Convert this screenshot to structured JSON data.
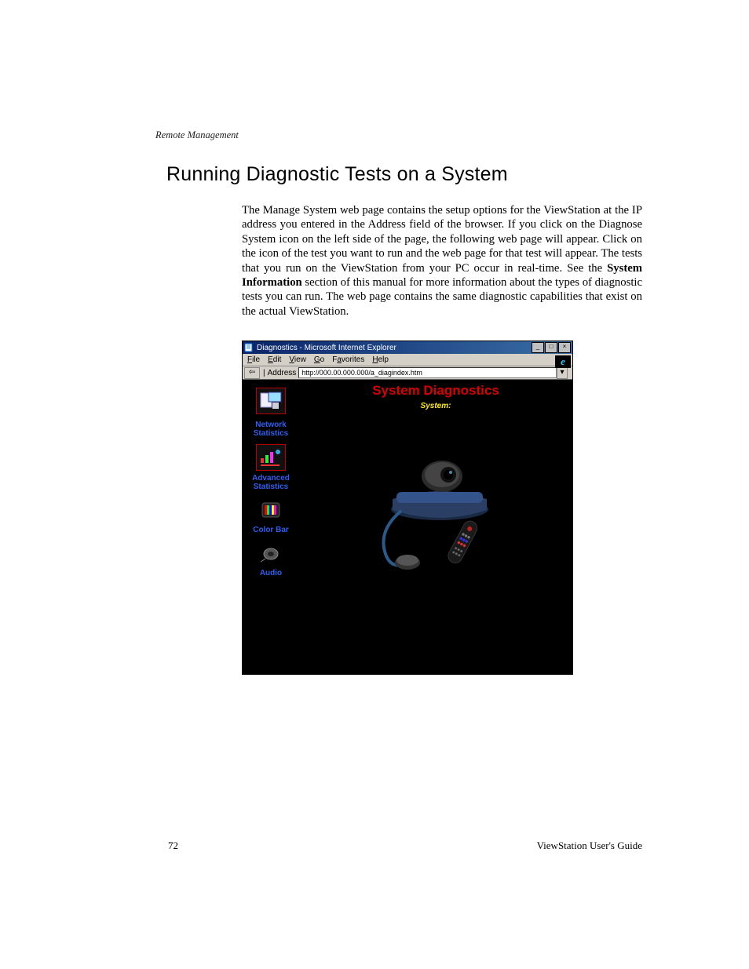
{
  "header": {
    "running_head": "Remote Management"
  },
  "section": {
    "title": "Running Diagnostic Tests on a System",
    "body_pre": "The Manage System web page contains the setup options for the ViewStation at the IP address you entered in the Address field of the browser. If you click on the Diagnose System icon on the left side of the page, the following web page will appear. Click on the icon of the test you want to run and the web page for that test will appear. The tests that you run on the ViewStation from your PC occur in real-time. See the ",
    "body_bold": "System Information",
    "body_post": " section of this manual for more information about the types of diagnostic tests you can run. The web page contains the same diagnostic capabilities that exist on the actual ViewStation."
  },
  "ie": {
    "title": "Diagnostics - Microsoft Internet Explorer",
    "menu": {
      "file": "File",
      "edit": "Edit",
      "view": "View",
      "go": "Go",
      "favorites": "Favorites",
      "help": "Help"
    },
    "address_label": "Address",
    "address_value": "http://000.00.000.000/a_diagindex.htm",
    "page": {
      "heading": "System Diagnostics",
      "subheading": "System:"
    },
    "sidebar": {
      "item1": "Network Statistics",
      "item2": "Advanced Statistics",
      "item3": "Color Bar",
      "item4": "Audio"
    }
  },
  "footer": {
    "page_number": "72",
    "guide": "ViewStation User's Guide"
  }
}
